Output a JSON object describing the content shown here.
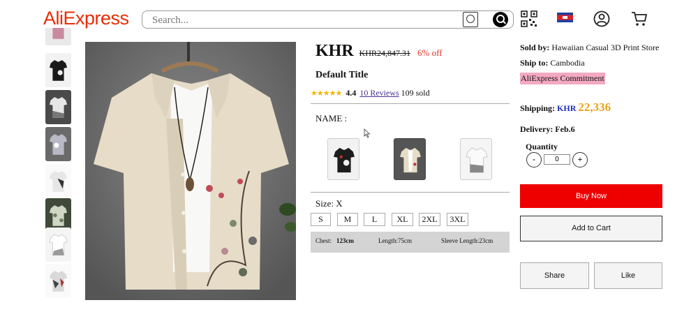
{
  "header": {
    "logo": "AliExpress",
    "search_placeholder": "Search...",
    "icons": [
      "qr-code-icon",
      "cambodia-flag-icon",
      "user-icon",
      "cart-icon"
    ]
  },
  "thumbnails": [
    {
      "name": "shirt-thumb-1",
      "color": "#c98aa0"
    },
    {
      "name": "shirt-thumb-2",
      "color": "#1b1b1b"
    },
    {
      "name": "shirt-thumb-3",
      "color": "#8f8f8f"
    },
    {
      "name": "shirt-thumb-4",
      "color": "#b9b9c6"
    },
    {
      "name": "shirt-thumb-5",
      "color": "#e6e6e6"
    },
    {
      "name": "shirt-thumb-6",
      "color": "#cfd6c4"
    },
    {
      "name": "shirt-thumb-7",
      "color": "#f4f4f4"
    },
    {
      "name": "shirt-thumb-8",
      "color": "#d9d9d9"
    }
  ],
  "product": {
    "currency": "KHR",
    "old_price": "KHR24,847.31",
    "discount": "6% off",
    "title": "Default Title",
    "stars": "★★★★★",
    "rating": "4.4",
    "reviews": "10 Reviews",
    "sold": "109 sold",
    "name_label": "NAME :",
    "variants": [
      "black-floral-shirt",
      "beige-floral-shirt",
      "white-floral-shirt"
    ],
    "selected_variant": 1,
    "size_label": "Size: X",
    "sizes": [
      "S",
      "M",
      "L",
      "XL",
      "2XL",
      "3XL"
    ],
    "measurements": {
      "chest_label": "Chest:",
      "chest_value": "123cm",
      "length": "Length:75cm",
      "sleeve": "Sleeve Length:23cm"
    }
  },
  "seller": {
    "sold_by_label": "Sold by:",
    "sold_by": "Hawaiian Casual 3D Print Store",
    "ship_to_label": "Ship to:",
    "ship_to": "Cambodia",
    "commitment": "AliExpress Commitment",
    "shipping_label": "Shipping:",
    "shipping_currency": "KHR",
    "shipping_value": "22,336",
    "delivery": "Delivery: Feb.6"
  },
  "quantity": {
    "label": "Quantity",
    "minus": "-",
    "plus": "+",
    "value": "0"
  },
  "actions": {
    "buy_now": "Buy Now",
    "add_to_cart": "Add to Cart",
    "share": "Share",
    "like": "Like"
  },
  "colors": {
    "brand": "#e62e04",
    "buy_button": "#ef0000",
    "shipping_value": "#e8a317",
    "commitment_bg": "#f3a9c1"
  }
}
